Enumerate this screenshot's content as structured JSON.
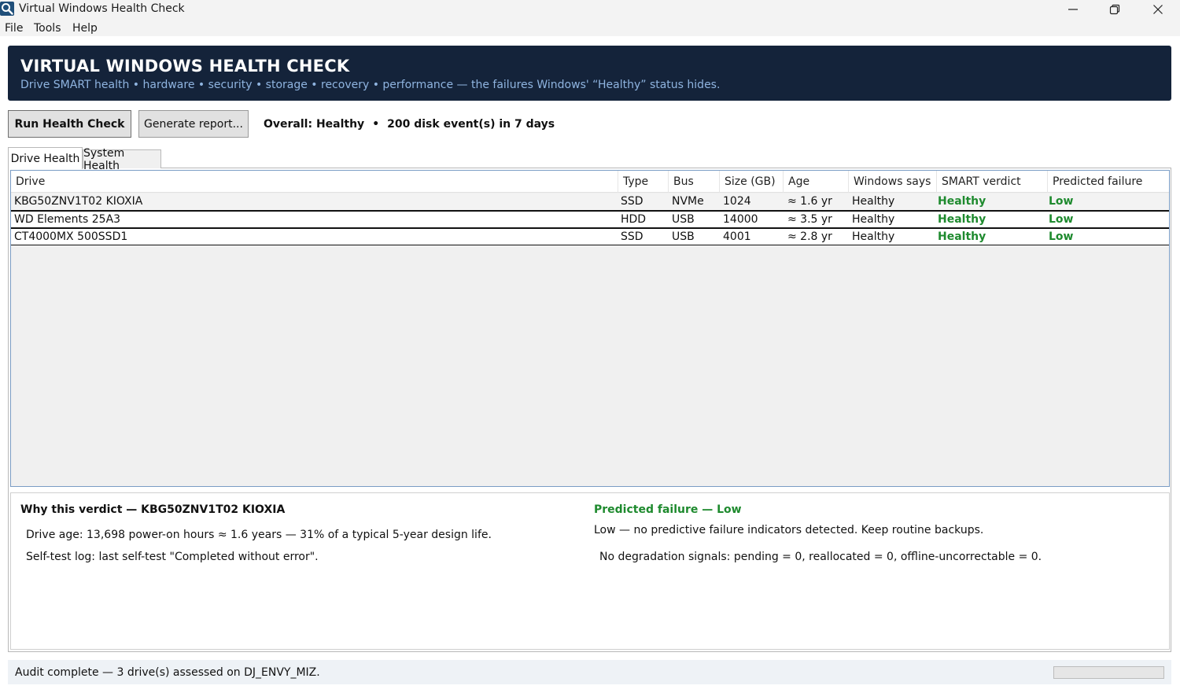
{
  "window": {
    "title": "Virtual Windows Health Check"
  },
  "menu": [
    "File",
    "Tools",
    "Help"
  ],
  "banner": {
    "title": "VIRTUAL WINDOWS HEALTH CHECK",
    "subtitle": "Drive SMART health • hardware • security • storage • recovery • performance — the failures Windows' “Healthy” status hides."
  },
  "toolbar": {
    "run_label": "Run Health Check",
    "report_label": "Generate report...",
    "overall": "Overall: Healthy",
    "separator": "•",
    "events": "200 disk event(s) in 7 days"
  },
  "tabs": [
    "Drive Health",
    "System Health"
  ],
  "drive_table": {
    "columns": [
      "Drive",
      "Type",
      "Bus",
      "Size (GB)",
      "Age",
      "Windows says",
      "SMART verdict",
      "Predicted failure"
    ],
    "rows": [
      [
        "KBG50ZNV1T02 KIOXIA",
        "SSD",
        "NVMe",
        "1024",
        "≈ 1.6 yr",
        "Healthy",
        "Healthy",
        "Low"
      ],
      [
        "WD Elements 25A3",
        "HDD",
        "USB",
        "14000",
        "≈ 3.5 yr",
        "Healthy",
        "Healthy",
        "Low"
      ],
      [
        "CT4000MX 500SSD1",
        "SSD",
        "USB",
        "4001",
        "≈ 2.8 yr",
        "Healthy",
        "Healthy",
        "Low"
      ]
    ],
    "selected_row": 0
  },
  "detail": {
    "heading": "Why this verdict — KBG50ZNV1T02 KIOXIA",
    "lines": [
      "Drive age: 13,698 power-on hours ≈ 1.6 years — 31% of a typical 5-year design life.",
      "Self-test log: last self-test \"Completed without error\"."
    ],
    "prediction_heading": "Predicted failure — Low",
    "prediction_summary": "Low — no predictive failure indicators detected. Keep routine backups.",
    "prediction_detail": "No degradation signals: pending = 0, reallocated = 0, offline-uncorrectable = 0."
  },
  "status": {
    "text": "Audit complete — 3 drive(s) assessed on DJ_ENVY_MIZ.",
    "progress": 0
  },
  "colors": {
    "banner": "#14233a",
    "banner_subtitle": "#8fb4e0",
    "good": "#1e8a2e",
    "list_border": "#7a9cc4"
  },
  "icons": {
    "app": "magnifier-icon",
    "minimize": "minimize-icon",
    "restore": "restore-icon",
    "close": "close-icon"
  }
}
